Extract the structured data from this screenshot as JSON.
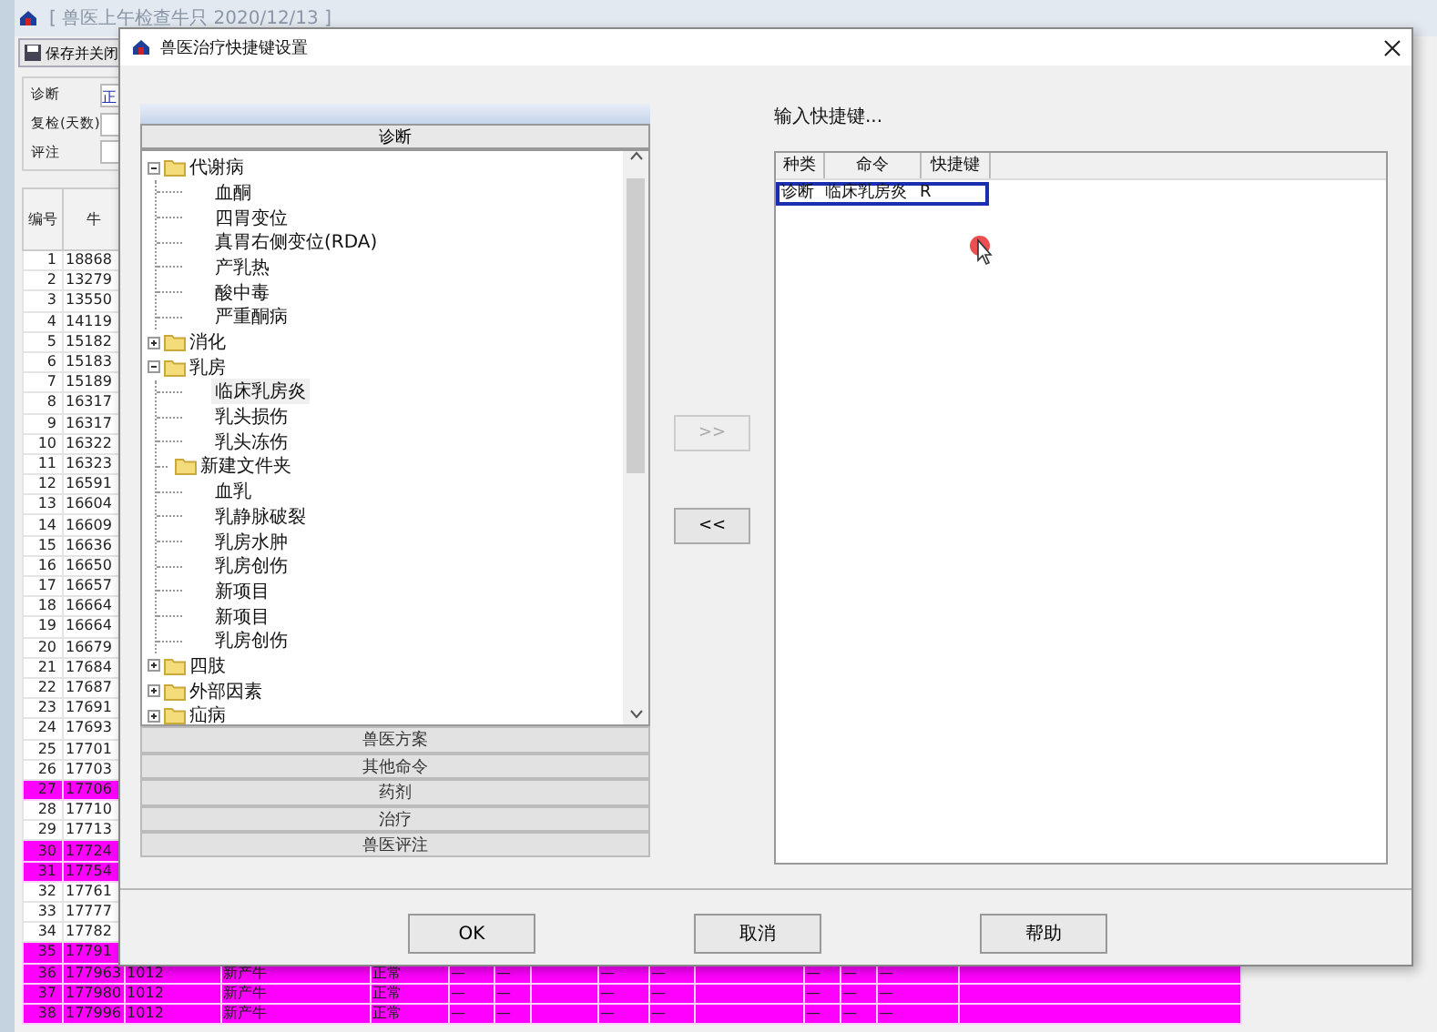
{
  "background_window": {
    "title": "[ 兽医上午检查牛只 2020/12/13 ]",
    "toolbar": [
      {
        "label": "保存并关闭"
      }
    ],
    "form": [
      {
        "label": "诊断",
        "value": "正"
      },
      {
        "label": "复检(天数)"
      },
      {
        "label": "评注"
      }
    ],
    "table": {
      "columns": [
        "编号",
        "牛"
      ],
      "rows": [
        {
          "cells": [
            "1",
            "18868"
          ],
          "highlighted": false
        },
        {
          "cells": [
            "2",
            "13279"
          ],
          "highlighted": false
        },
        {
          "cells": [
            "3",
            "13550"
          ],
          "highlighted": false
        },
        {
          "cells": [
            "4",
            "14119"
          ],
          "highlighted": false
        },
        {
          "cells": [
            "5",
            "15182"
          ],
          "highlighted": false
        },
        {
          "cells": [
            "6",
            "15183"
          ],
          "highlighted": false
        },
        {
          "cells": [
            "7",
            "15189"
          ],
          "highlighted": false
        },
        {
          "cells": [
            "8",
            "16317"
          ],
          "highlighted": false
        },
        {
          "cells": [
            "9",
            "16317"
          ],
          "highlighted": false
        },
        {
          "cells": [
            "10",
            "16322"
          ],
          "highlighted": false
        },
        {
          "cells": [
            "11",
            "16323"
          ],
          "highlighted": false
        },
        {
          "cells": [
            "12",
            "16591"
          ],
          "highlighted": false
        },
        {
          "cells": [
            "13",
            "16604"
          ],
          "highlighted": false
        },
        {
          "cells": [
            "14",
            "16609"
          ],
          "highlighted": false
        },
        {
          "cells": [
            "15",
            "16636"
          ],
          "highlighted": false
        },
        {
          "cells": [
            "16",
            "16650"
          ],
          "highlighted": false
        },
        {
          "cells": [
            "17",
            "16657"
          ],
          "highlighted": false
        },
        {
          "cells": [
            "18",
            "16664"
          ],
          "highlighted": false
        },
        {
          "cells": [
            "19",
            "16664"
          ],
          "highlighted": false
        },
        {
          "cells": [
            "20",
            "16679"
          ],
          "highlighted": false
        },
        {
          "cells": [
            "21",
            "17684"
          ],
          "highlighted": false
        },
        {
          "cells": [
            "22",
            "17687"
          ],
          "highlighted": false
        },
        {
          "cells": [
            "23",
            "17691"
          ],
          "highlighted": false
        },
        {
          "cells": [
            "24",
            "17693"
          ],
          "highlighted": false
        },
        {
          "cells": [
            "25",
            "17701"
          ],
          "highlighted": false
        },
        {
          "cells": [
            "26",
            "17703"
          ],
          "highlighted": false
        },
        {
          "cells": [
            "27",
            "17706"
          ],
          "highlighted": true
        },
        {
          "cells": [
            "28",
            "17710"
          ],
          "highlighted": false
        },
        {
          "cells": [
            "29",
            "17713"
          ],
          "highlighted": false
        },
        {
          "cells": [
            "30",
            "17724"
          ],
          "highlighted": true
        },
        {
          "cells": [
            "31",
            "17754"
          ],
          "highlighted": true
        },
        {
          "cells": [
            "32",
            "17761"
          ],
          "highlighted": false
        },
        {
          "cells": [
            "33",
            "17777"
          ],
          "highlighted": false
        },
        {
          "cells": [
            "34",
            "17782"
          ],
          "highlighted": false
        },
        {
          "cells": [
            "35",
            "17791"
          ],
          "highlighted": true
        },
        {
          "cells": [
            "36",
            "177963",
            "1012",
            "新产牛",
            "正常",
            "—",
            "—",
            "",
            "—",
            "—",
            "",
            "—",
            "—",
            "—"
          ],
          "highlighted": true
        },
        {
          "cells": [
            "37",
            "177980",
            "1012",
            "新产牛",
            "正常",
            "—",
            "—",
            "",
            "—",
            "—",
            "",
            "—",
            "—",
            "—"
          ],
          "highlighted": true
        },
        {
          "cells": [
            "38",
            "177996",
            "1012",
            "新产牛",
            "正常",
            "—",
            "—",
            "",
            "—",
            "—",
            "",
            "—",
            "—",
            "—"
          ],
          "highlighted": true
        }
      ]
    }
  },
  "dialog": {
    "title": "兽医治疗快捷键设置",
    "category_panel": {
      "sections": [
        {
          "label": "诊断",
          "selected": true
        },
        {
          "label": "兽医方案",
          "selected": false
        },
        {
          "label": "其他命令",
          "selected": false
        },
        {
          "label": "药剂",
          "selected": false
        },
        {
          "label": "治疗",
          "selected": false
        },
        {
          "label": "兽医评注",
          "selected": false
        }
      ],
      "tree": [
        {
          "label": "代谢病",
          "kind": "folder",
          "expanded": true,
          "selected": false,
          "children": [
            {
              "label": "血酮",
              "kind": "item",
              "selected": false
            },
            {
              "label": "四胃变位",
              "kind": "item",
              "selected": false
            },
            {
              "label": "真胃右侧变位(RDA)",
              "kind": "item",
              "selected": false
            },
            {
              "label": "产乳热",
              "kind": "item",
              "selected": false
            },
            {
              "label": "酸中毒",
              "kind": "item",
              "selected": false
            },
            {
              "label": "严重酮病",
              "kind": "item",
              "selected": false
            }
          ]
        },
        {
          "label": "消化",
          "kind": "folder",
          "expanded": false,
          "selected": false
        },
        {
          "label": "乳房",
          "kind": "folder",
          "expanded": true,
          "selected": false,
          "children": [
            {
              "label": "临床乳房炎",
              "kind": "item",
              "selected": true
            },
            {
              "label": "乳头损伤",
              "kind": "item",
              "selected": false
            },
            {
              "label": "乳头冻伤",
              "kind": "item",
              "selected": false
            },
            {
              "label": "新建文件夹",
              "kind": "subfolder",
              "selected": false
            },
            {
              "label": "血乳",
              "kind": "item",
              "selected": false
            },
            {
              "label": "乳静脉破裂",
              "kind": "item",
              "selected": false
            },
            {
              "label": "乳房水肿",
              "kind": "item",
              "selected": false
            },
            {
              "label": "乳房创伤",
              "kind": "item",
              "selected": false
            },
            {
              "label": "新项目",
              "kind": "item",
              "selected": false
            },
            {
              "label": "新项目",
              "kind": "item",
              "selected": false
            },
            {
              "label": "乳房创伤",
              "kind": "item",
              "selected": false
            }
          ]
        },
        {
          "label": "四肢",
          "kind": "folder",
          "expanded": false,
          "selected": false
        },
        {
          "label": "外部因素",
          "kind": "folder",
          "expanded": false,
          "selected": false
        },
        {
          "label": "疝病",
          "kind": "folder",
          "expanded": false,
          "selected": false
        }
      ]
    },
    "add_button": {
      "label": ">>",
      "disabled": true
    },
    "remove_button": {
      "label": "<<",
      "disabled": false
    },
    "prompt": "输入快捷键...",
    "shortcut_table": {
      "columns": [
        "种类",
        "命令",
        "快捷键"
      ],
      "rows": [
        {
          "cells": [
            "诊断",
            "临床乳房炎",
            "R"
          ],
          "selected": true
        }
      ]
    },
    "buttons": [
      {
        "label": "OK"
      },
      {
        "label": "取消"
      },
      {
        "label": "帮助"
      }
    ]
  }
}
